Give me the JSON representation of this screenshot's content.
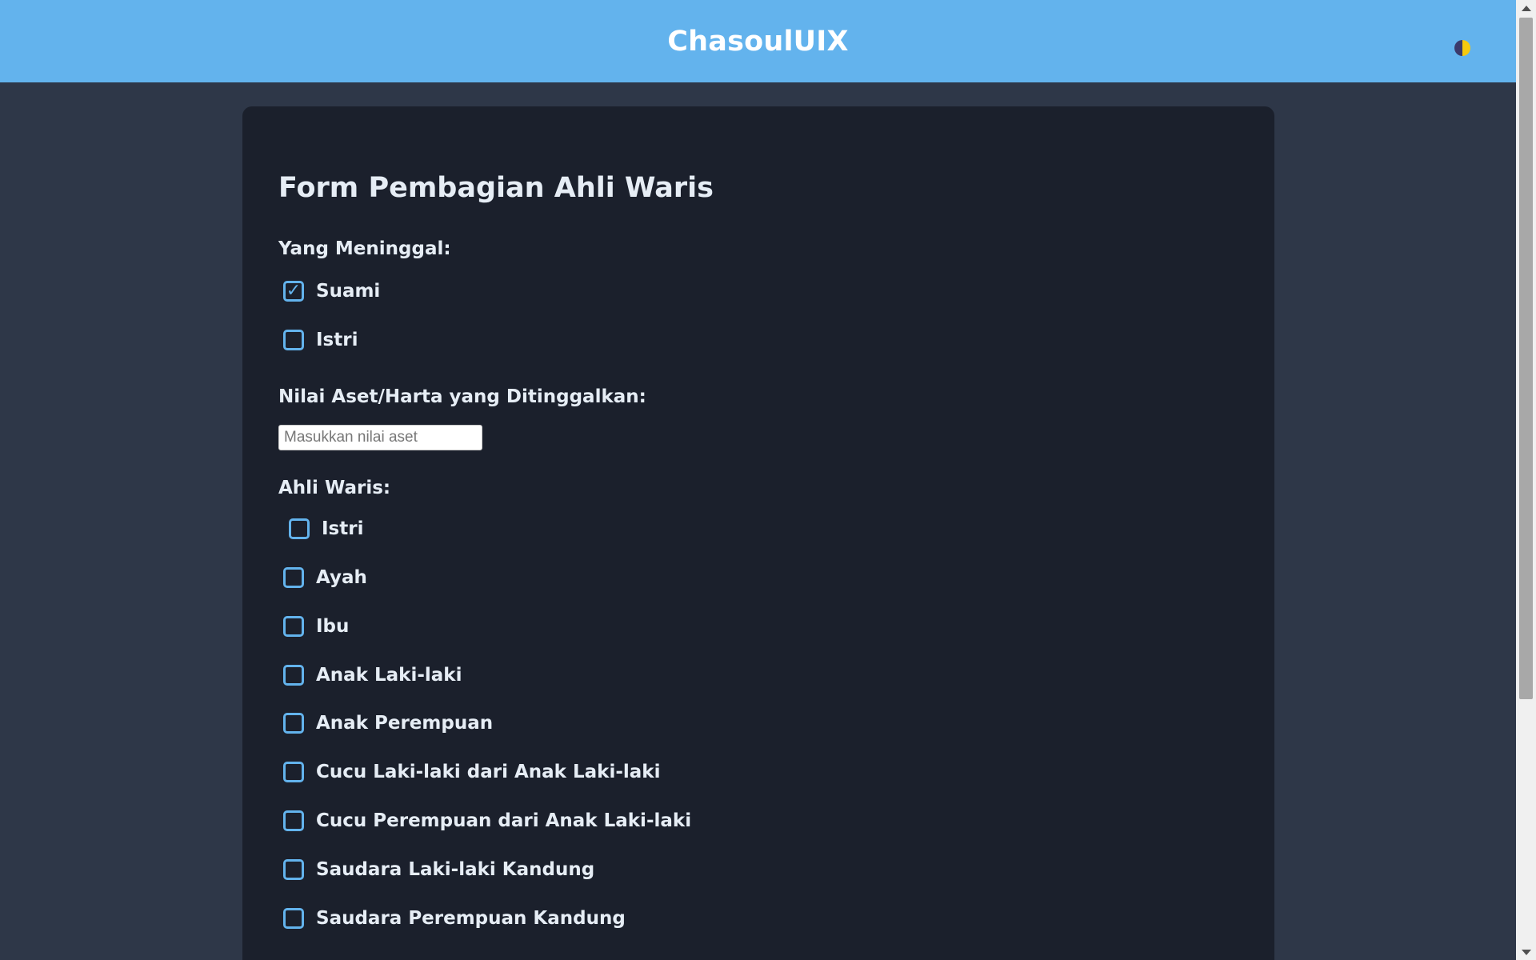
{
  "header": {
    "title": "ChasoulUIX",
    "theme_toggle": "theme-toggle-icon"
  },
  "form": {
    "title": "Form Pembagian Ahli Waris",
    "deceased": {
      "label": "Yang Meninggal:",
      "options": [
        {
          "label": "Suami",
          "checked": true
        },
        {
          "label": "Istri",
          "checked": false
        }
      ]
    },
    "asset": {
      "label": "Nilai Aset/Harta yang Ditinggalkan:",
      "value": "",
      "placeholder": "Masukkan nilai aset"
    },
    "heirs": {
      "label": "Ahli Waris:",
      "options": [
        {
          "label": "Istri",
          "checked": false
        },
        {
          "label": "Ayah",
          "checked": false
        },
        {
          "label": "Ibu",
          "checked": false
        },
        {
          "label": "Anak Laki-laki",
          "checked": false
        },
        {
          "label": "Anak Perempuan",
          "checked": false
        },
        {
          "label": "Cucu Laki-laki dari Anak Laki-laki",
          "checked": false
        },
        {
          "label": "Cucu Perempuan dari Anak Laki-laki",
          "checked": false
        },
        {
          "label": "Saudara Laki-laki Kandung",
          "checked": false
        },
        {
          "label": "Saudara Perempuan Kandung",
          "checked": false
        }
      ]
    }
  },
  "colors": {
    "header_bg": "#63b3ed",
    "page_bg": "#2e3748",
    "card_bg": "#1b202c",
    "accent": "#63b3ed",
    "text": "#e6edf5"
  }
}
